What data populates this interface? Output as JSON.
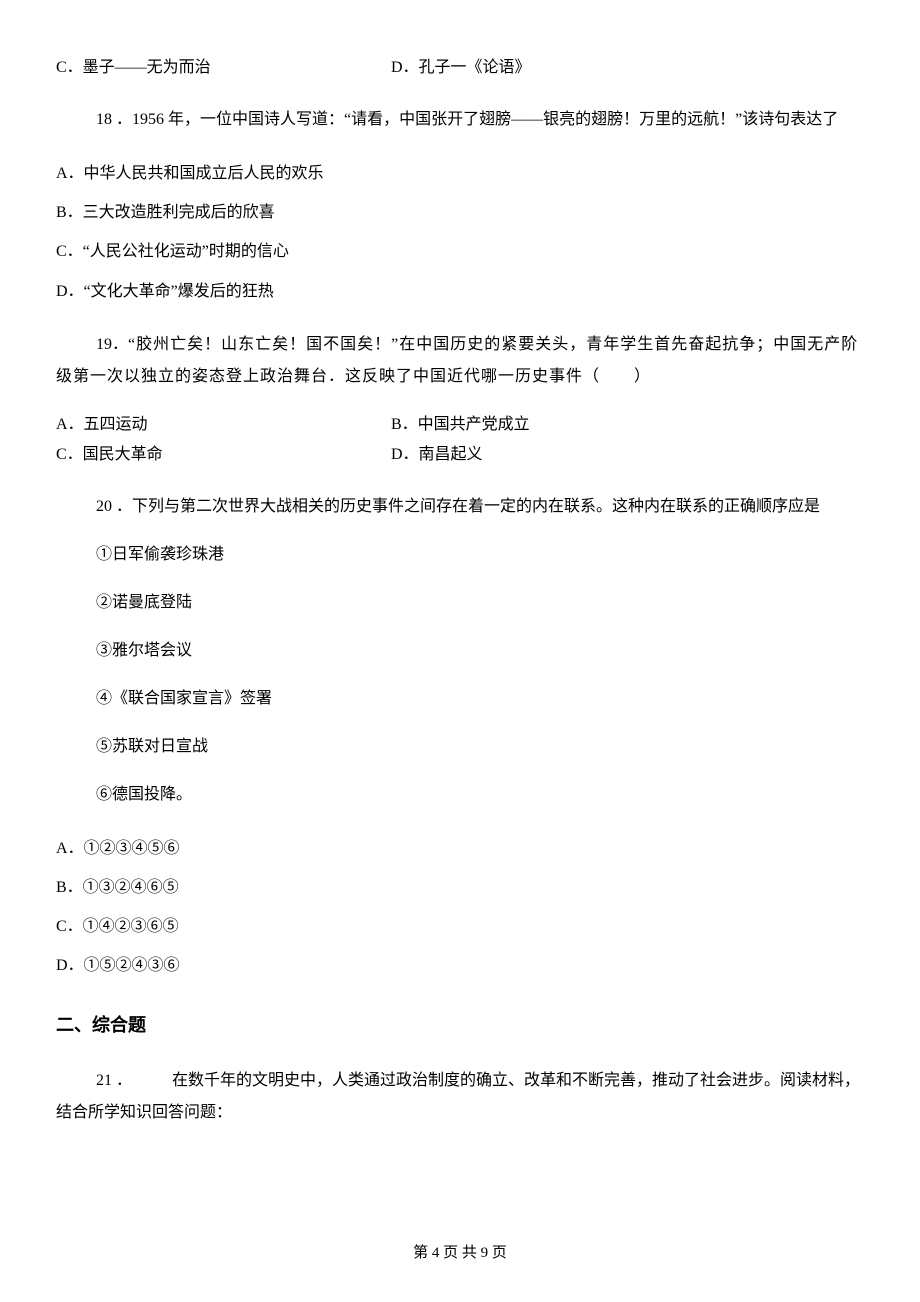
{
  "q17": {
    "optC": "C．墨子——无为而治",
    "optD": "D．孔子一《论语》"
  },
  "q18": {
    "num": "18 ．",
    "stem": "1956 年，一位中国诗人写道：“请看，中国张开了翅膀——银亮的翅膀！万里的远航！”该诗句表达了",
    "optA": "A．中华人民共和国成立后人民的欢乐",
    "optB": "B．三大改造胜利完成后的欣喜",
    "optC": "C．“人民公社化运动”时期的信心",
    "optD": "D．“文化大革命”爆发后的狂热"
  },
  "q19": {
    "num": "19．",
    "stem": "“胶州亡矣！山东亡矣！国不国矣！”在中国历史的紧要关头，青年学生首先奋起抗争；中国无产阶级第一次以独立的姿态登上政治舞台．这反映了中国近代哪一历史事件（　　）",
    "optA": "A．五四运动",
    "optB": "B．中国共产党成立",
    "optC": "C．国民大革命",
    "optD": "D．南昌起义"
  },
  "q20": {
    "num": "20 ．",
    "stem": "下列与第二次世界大战相关的历史事件之间存在着一定的内在联系。这种内在联系的正确顺序应是",
    "item1": "①日军偷袭珍珠港",
    "item2": "②诺曼底登陆",
    "item3": "③雅尔塔会议",
    "item4": "④《联合国家宣言》签署",
    "item5": "⑤苏联对日宣战",
    "item6": "⑥德国投降。",
    "optA": "A．①②③④⑤⑥",
    "optB": "B．①③②④⑥⑤",
    "optC": "C．①④②③⑥⑤",
    "optD": "D．①⑤②④③⑥"
  },
  "section2": "二、综合题",
  "q21": {
    "num": "21 ．",
    "stem": "　　　在数千年的文明史中，人类通过政治制度的确立、改革和不断完善，推动了社会进步。阅读材料，结合所学知识回答问题："
  },
  "footer": "第 4 页 共 9 页"
}
